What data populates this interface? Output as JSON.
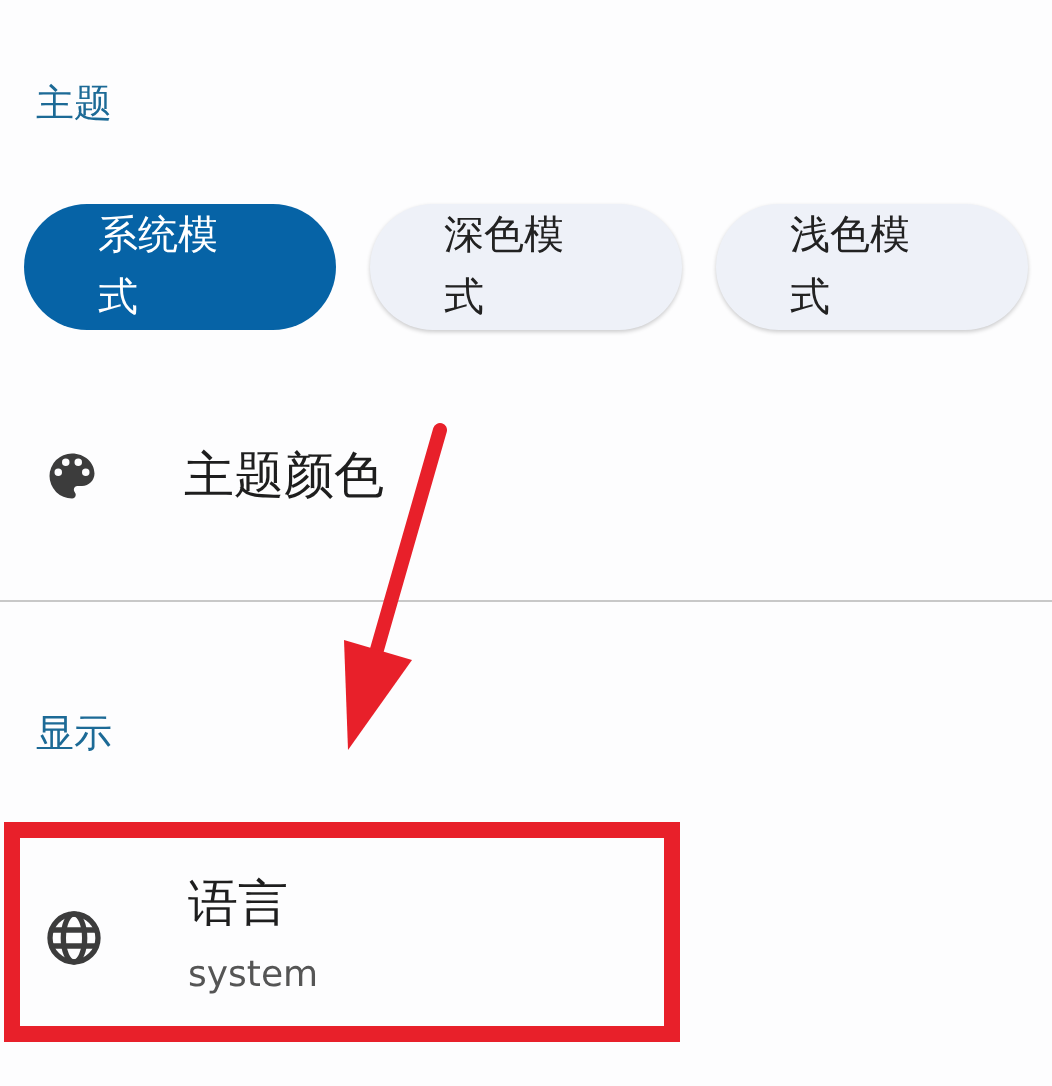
{
  "sections": [
    {
      "header": "主题",
      "theme_modes": [
        {
          "label": "系统模式",
          "selected": true
        },
        {
          "label": "深色模式",
          "selected": false
        },
        {
          "label": "浅色模式",
          "selected": false
        }
      ],
      "items": [
        {
          "kind": "palette",
          "title": "主题颜色"
        }
      ]
    },
    {
      "header": "显示",
      "items": [
        {
          "kind": "globe",
          "title": "语言",
          "subtitle": "system"
        }
      ]
    }
  ]
}
